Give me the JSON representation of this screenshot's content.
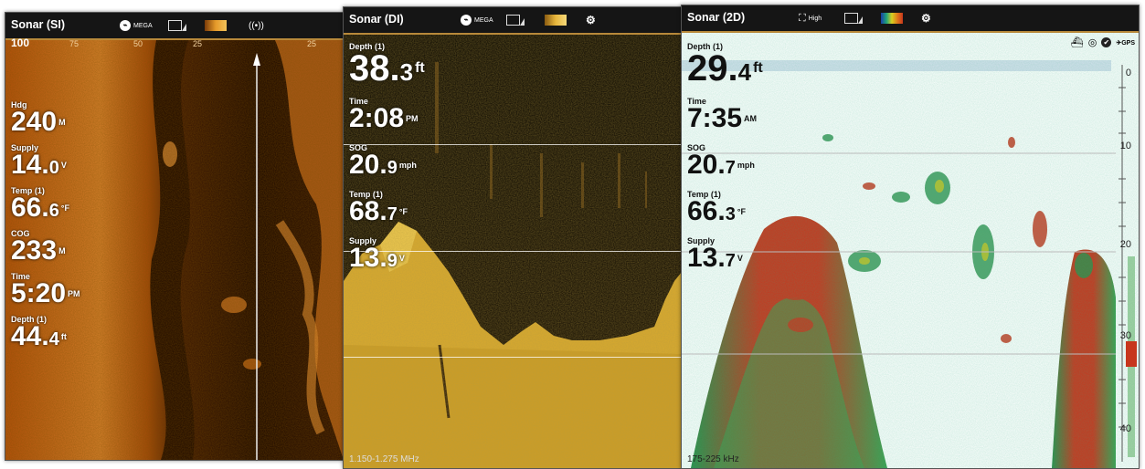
{
  "panels": {
    "si": {
      "title": "Sonar (SI)",
      "icons": [
        "sonar-mega-icon",
        "screen-adjust-icon",
        "palette-icon",
        "sonar-ping-icon"
      ],
      "mega_label": "MEGA",
      "range_left": "100",
      "range_ticks": [
        "75",
        "50",
        "25",
        "25"
      ],
      "overlays": [
        {
          "label": "Hdg",
          "int": "240",
          "dec": "",
          "unit": "M"
        },
        {
          "label": "Supply",
          "int": "14.",
          "dec": "0",
          "unit": "V"
        },
        {
          "label": "Temp (1)",
          "int": "66.",
          "dec": "6",
          "unit": "°F"
        },
        {
          "label": "COG",
          "int": "233",
          "dec": "",
          "unit": "M"
        },
        {
          "label": "Time",
          "int": "5:20",
          "dec": "",
          "unit": "PM"
        },
        {
          "label": "Depth (1)",
          "int": "44.",
          "dec": "4",
          "unit": "ft"
        }
      ]
    },
    "di": {
      "title": "Sonar (DI)",
      "icons": [
        "sonar-mega-icon",
        "screen-adjust-icon",
        "palette-icon",
        "gear-search-icon"
      ],
      "mega_label": "MEGA",
      "overlays": [
        {
          "label": "Depth (1)",
          "int": "38.",
          "dec": "3",
          "unit": "ft",
          "big": true
        },
        {
          "label": "Time",
          "int": "2:08",
          "dec": "",
          "unit": "PM"
        },
        {
          "label": "SOG",
          "int": "20.",
          "dec": "9",
          "unit": "mph"
        },
        {
          "label": "Temp (1)",
          "int": "68.",
          "dec": "7",
          "unit": "°F"
        },
        {
          "label": "Supply",
          "int": "13.",
          "dec": "9",
          "unit": "V"
        }
      ],
      "frequency": "1.150-1.275 MHz"
    },
    "d2": {
      "title": "Sonar (2D)",
      "icons": [
        "fish-high-icon",
        "screen-adjust-icon",
        "palette-icon",
        "gear-search-icon"
      ],
      "high_label": "High",
      "status_icons": [
        "boat-icon",
        "target-icon",
        "check-icon",
        "gps-icon"
      ],
      "gps_label": "GPS",
      "overlays": [
        {
          "label": "Depth (1)",
          "int": "29.",
          "dec": "4",
          "unit": "ft",
          "big": true
        },
        {
          "label": "Time",
          "int": "7:35",
          "dec": "",
          "unit": "AM"
        },
        {
          "label": "SOG",
          "int": "20.",
          "dec": "7",
          "unit": "mph"
        },
        {
          "label": "Temp (1)",
          "int": "66.",
          "dec": "3",
          "unit": "°F"
        },
        {
          "label": "Supply",
          "int": "13.",
          "dec": "7",
          "unit": "V"
        }
      ],
      "scale": [
        "0",
        "10",
        "20",
        "30",
        "40"
      ],
      "frequency": "175-225 kHz"
    }
  },
  "colors": {
    "titlebar": "#151515",
    "accent": "#b8893a",
    "si_tone": "#c86a18",
    "di_tone": "#e2b53a",
    "d2_red": "#c7361d"
  }
}
